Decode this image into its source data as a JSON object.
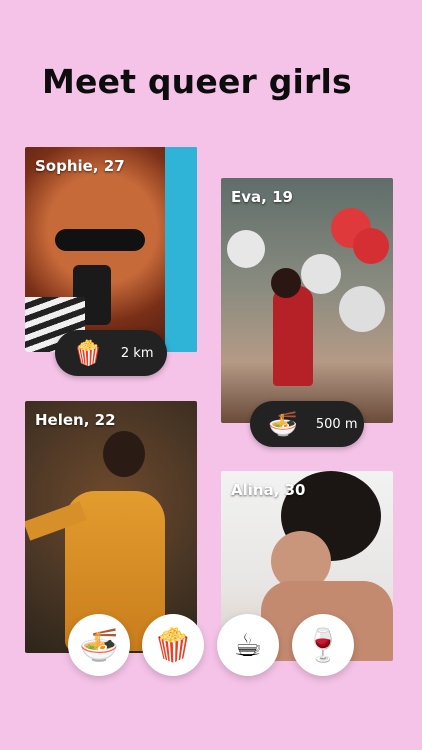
{
  "headline": "Meet queer girls",
  "profiles": [
    {
      "name": "Sophie, 27",
      "interest_icon": "🍿",
      "distance": "2 km"
    },
    {
      "name": "Eva, 19",
      "interest_icon": "🍜",
      "distance": "500 m"
    },
    {
      "name": "Helen, 22"
    },
    {
      "name": "Alina, 30"
    }
  ],
  "interests": [
    {
      "icon": "🍜",
      "name": "noodles-icon"
    },
    {
      "icon": "🍿",
      "name": "popcorn-icon"
    },
    {
      "icon": "☕",
      "name": "coffee-icon"
    },
    {
      "icon": "🍷",
      "name": "wine-icon"
    }
  ],
  "colors": {
    "background": "#f6c3e8",
    "pill": "#222222",
    "headline": "#0d0d0d"
  }
}
